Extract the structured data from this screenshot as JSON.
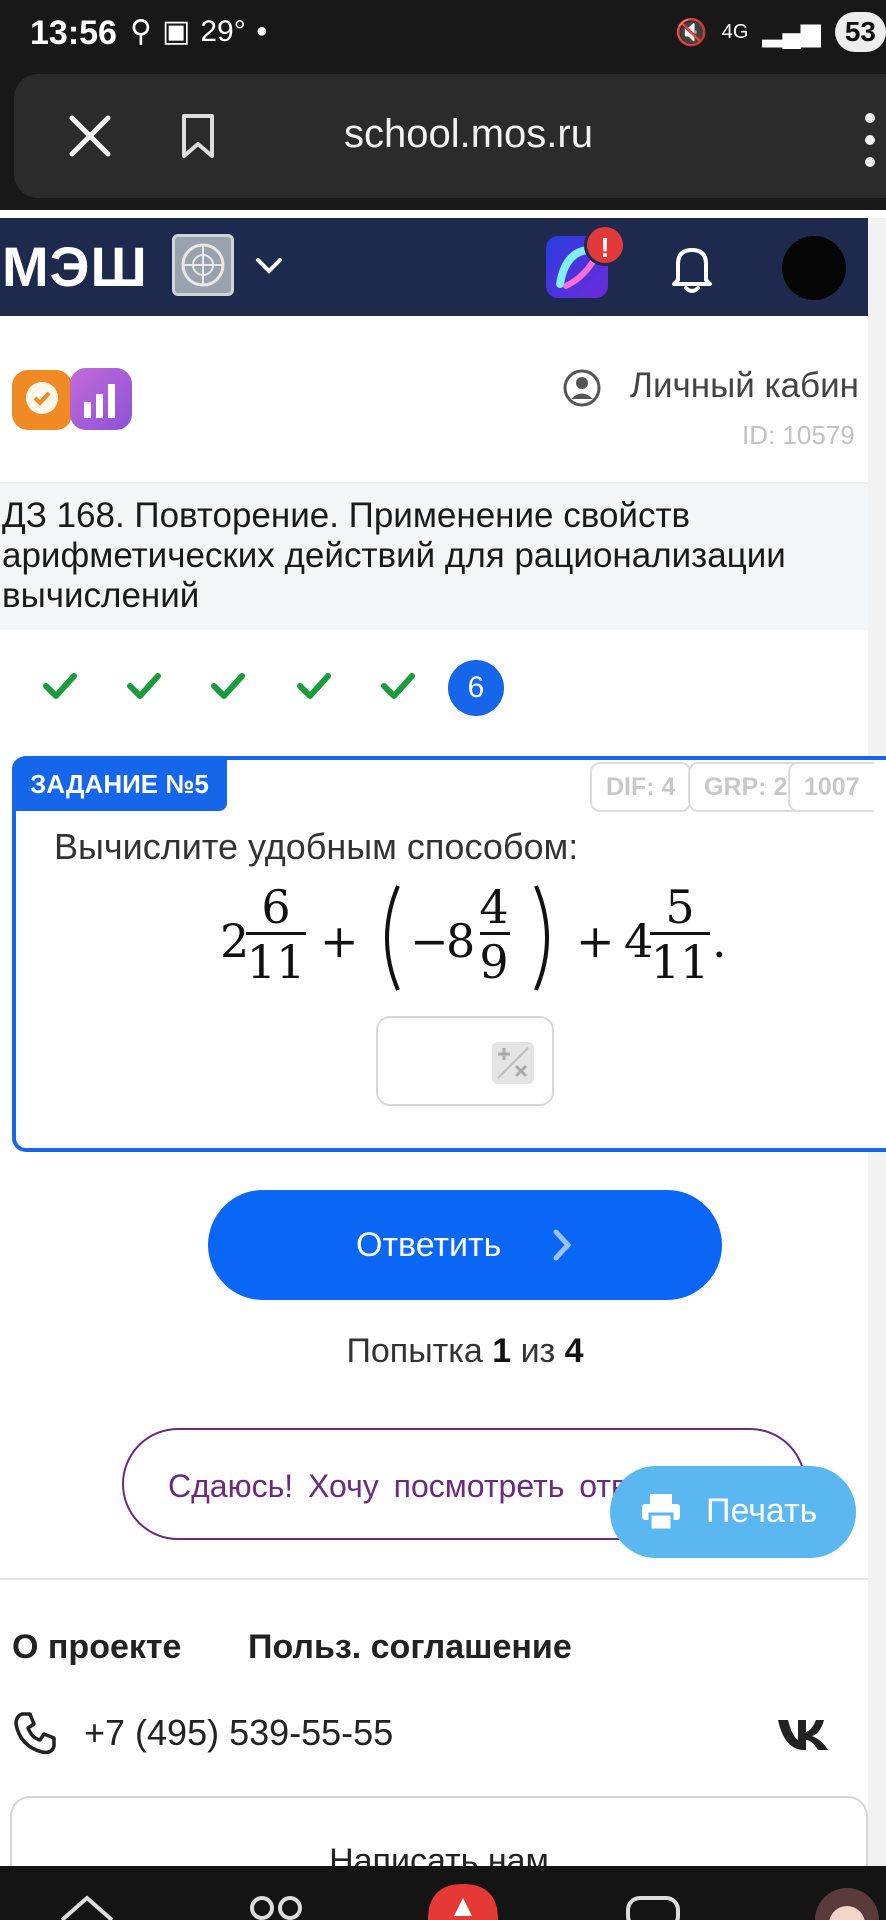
{
  "status_bar": {
    "time": "13:56",
    "temperature": "29°",
    "network": "4G",
    "battery": "53"
  },
  "browser": {
    "url": "school.mos.ru"
  },
  "header": {
    "logo": "МЭШ",
    "notification_badge": "!"
  },
  "cabinet": {
    "label": "Личный кабин",
    "id": "ID: 10579"
  },
  "lesson": {
    "title": "ДЗ 168. Повторение. Применение свойств арифметических действий для рационализации вычислений"
  },
  "progress": {
    "current_step": "6"
  },
  "task": {
    "label": "ЗАДАНИЕ №5",
    "tags": [
      "DIF: 4",
      "GRP: 2",
      "1007"
    ],
    "instruction": "Вычислите удобным способом:",
    "expression": {
      "term1": {
        "whole": "2",
        "num": "6",
        "den": "11"
      },
      "op1": "+",
      "term2": {
        "sign": "−",
        "whole": "8",
        "num": "4",
        "den": "9"
      },
      "op2": "+",
      "term3": {
        "whole": "4",
        "num": "5",
        "den": "11"
      },
      "end": "."
    },
    "answer_value": ""
  },
  "actions": {
    "submit": "Ответить",
    "attempt_prefix": "Попытка",
    "attempt_current": "1",
    "attempt_sep": "из",
    "attempt_total": "4",
    "giveup": "Сдаюсь! Хочу посмотреть ответ",
    "print": "Печать"
  },
  "footer": {
    "about": "О проекте",
    "agreement": "Польз. соглашение",
    "phone": "+7 (495) 539-55-55",
    "write": "Написать нам"
  }
}
